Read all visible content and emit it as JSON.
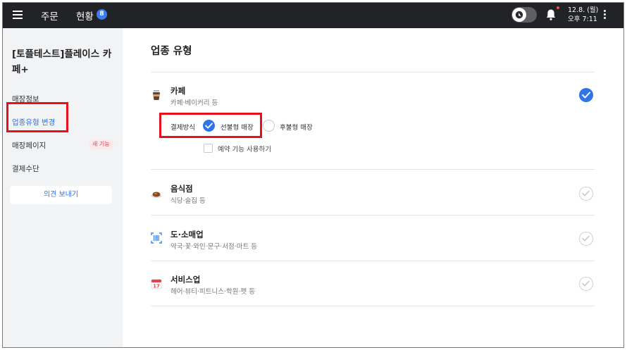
{
  "topbar": {
    "menu_icon": "hamburger-icon",
    "order_label": "주문",
    "status_label": "현황",
    "status_badge": "8",
    "date": "12.8. (월)",
    "time": "오후 7:11",
    "bell_icon": "bell-icon",
    "more_icon": "kebab-menu-icon",
    "accent_color": "#3a7ff2"
  },
  "sidebar": {
    "store_name": "[토플테스트]플레이스 카페+",
    "items": [
      {
        "label": "매장정보"
      },
      {
        "label": "업종유형 변경",
        "active": true
      },
      {
        "label": "매장페이지",
        "badge": "새 기능"
      },
      {
        "label": "결제수단"
      }
    ],
    "feedback_button": "의견 보내기"
  },
  "main": {
    "title": "업종 유형",
    "categories": [
      {
        "name": "카페",
        "desc": "카페·베이커리 등",
        "icon": "coffee-cup-icon",
        "selected": true
      },
      {
        "name": "음식점",
        "desc": "식당·술집 등",
        "icon": "food-plate-icon",
        "selected": false
      },
      {
        "name": "도·소매업",
        "desc": "약국·꽃·와인·문구·서점·마트 등",
        "icon": "barcode-icon",
        "selected": false
      },
      {
        "name": "서비스업",
        "desc": "헤어·뷰티·피트니스·학원·펫 등",
        "icon": "calendar-icon",
        "selected": false
      }
    ],
    "payment": {
      "label": "결제방식",
      "option_prepaid": "선불형 매장",
      "option_postpaid": "후불형 매장",
      "selected": "선불형 매장"
    },
    "reservation_checkbox": "예약 기능 사용하기",
    "calendar_icon_text": "17"
  },
  "colors": {
    "accent": "#2f74e8",
    "highlight": "#e8101a"
  }
}
